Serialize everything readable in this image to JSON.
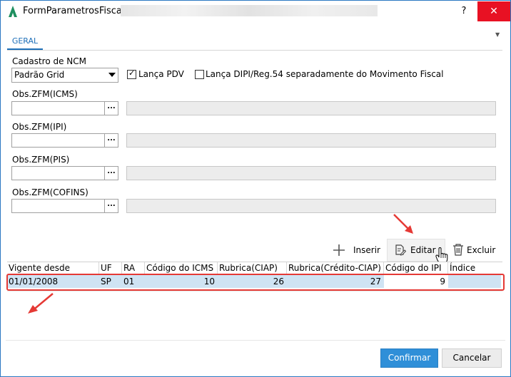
{
  "window": {
    "title": "FormParametrosFiscais",
    "help_glyph": "?",
    "close_glyph": "✕"
  },
  "tabs": [
    {
      "label": "GERAL"
    }
  ],
  "form": {
    "cadastro_ncm_label": "Cadastro de NCM",
    "cadastro_ncm_value": "Padrão Grid",
    "lanca_pdv_label": "Lança PDV",
    "lanca_pdv_checked": true,
    "lanca_dipi_label": "Lança DIPI/Reg.54 separadamente do Movimento Fiscal",
    "lanca_dipi_checked": false,
    "obs_icms_label": "Obs.ZFM(ICMS)",
    "obs_ipi_label": "Obs.ZFM(IPI)",
    "obs_pis_label": "Obs.ZFM(PIS)",
    "obs_cofins_label": "Obs.ZFM(COFINS)",
    "lookup_glyph": "..."
  },
  "toolbar": {
    "inserir": "Inserir",
    "editar": "Editar",
    "excluir": "Excluir"
  },
  "grid": {
    "columns": [
      "Vigente desde",
      "UF",
      "RA",
      "Código do ICMS",
      "Rubrica(CIAP)",
      "Rubrica(Crédito-CIAP)",
      "Código do IPI",
      "Índice"
    ],
    "rows": [
      [
        "01/01/2008",
        "SP",
        "01",
        "10",
        "26",
        "27",
        "9",
        ""
      ]
    ]
  },
  "footer": {
    "confirmar": "Confirmar",
    "cancelar": "Cancelar"
  },
  "colors": {
    "accent": "#2f8fd8",
    "close": "#e81123",
    "selected_row": "#cfe3f3",
    "annotation": "#e53935"
  }
}
